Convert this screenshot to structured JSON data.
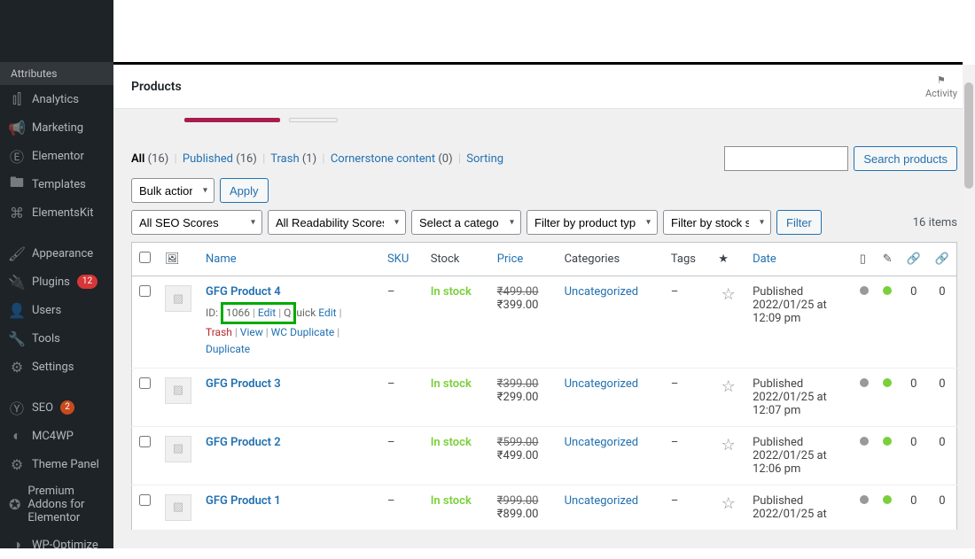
{
  "sidebar": {
    "attributes": "Attributes",
    "items": [
      {
        "icon": "analytics-icon",
        "glyph": "⫾⫿",
        "label": "Analytics"
      },
      {
        "icon": "marketing-icon",
        "glyph": "📢",
        "label": "Marketing"
      },
      {
        "icon": "elementor-icon",
        "glyph": "Ⓔ",
        "label": "Elementor"
      },
      {
        "icon": "templates-icon",
        "glyph": "🖿",
        "label": "Templates"
      },
      {
        "icon": "elementskit-icon",
        "glyph": "⌘",
        "label": "ElementsKit"
      },
      {
        "icon": "appearance-icon",
        "glyph": "🖌",
        "label": "Appearance"
      },
      {
        "icon": "plugins-icon",
        "glyph": "🔌",
        "label": "Plugins",
        "badge": "12",
        "badge_class": "badge-red"
      },
      {
        "icon": "users-icon",
        "glyph": "👤",
        "label": "Users"
      },
      {
        "icon": "tools-icon",
        "glyph": "🔧",
        "label": "Tools"
      },
      {
        "icon": "settings-icon",
        "glyph": "⚙",
        "label": "Settings"
      },
      {
        "icon": "seo-icon",
        "glyph": "Ⓨ",
        "label": "SEO",
        "badge": "2",
        "badge_class": "badge-orange"
      },
      {
        "icon": "mc4wp-icon",
        "glyph": "◐",
        "label": "MC4WP"
      },
      {
        "icon": "theme-panel-icon",
        "glyph": "⚙",
        "label": "Theme Panel"
      },
      {
        "icon": "premium-addons-icon",
        "glyph": "✪",
        "label": "Premium Addons for Elementor"
      },
      {
        "icon": "wp-optimize-icon",
        "glyph": "◑",
        "label": "WP-Optimize"
      }
    ]
  },
  "header": {
    "title": "Products",
    "activity": "Activity"
  },
  "filters": {
    "all": "All",
    "all_count": "(16)",
    "published": "Published",
    "published_count": "(16)",
    "trash": "Trash",
    "trash_count": "(1)",
    "cornerstone": "Cornerstone content",
    "cornerstone_count": "(0)",
    "sorting": "Sorting",
    "search_btn": "Search products",
    "bulk": "Bulk actions",
    "apply": "Apply",
    "seo": "All SEO Scores",
    "readability": "All Readability Scores",
    "category": "Select a category",
    "ptype": "Filter by product type",
    "stock": "Filter by stock status",
    "filter_btn": "Filter",
    "items": "16 items"
  },
  "columns": {
    "name": "Name",
    "sku": "SKU",
    "stock": "Stock",
    "price": "Price",
    "categories": "Categories",
    "tags": "Tags",
    "date": "Date"
  },
  "row_actions": {
    "id_prefix": "ID: ",
    "edit": "Edit",
    "quick_edit": "Quick Edit",
    "trash": "Trash",
    "view": "View",
    "wc_dup": "WC Duplicate",
    "dup": "Duplicate"
  },
  "products": [
    {
      "name": "GFG Product 4",
      "id": "1066",
      "sku": "–",
      "stock": "In stock",
      "price_old": "₹499.00",
      "price_new": "₹399.00",
      "category": "Uncategorized",
      "tags": "–",
      "date_label": "Published",
      "date_line2": "2022/01/25 at",
      "date_line3": "12:09 pm",
      "c1": "0",
      "c2": "0",
      "show_actions": true
    },
    {
      "name": "GFG Product 3",
      "sku": "–",
      "stock": "In stock",
      "price_old": "₹399.00",
      "price_new": "₹299.00",
      "category": "Uncategorized",
      "tags": "–",
      "date_label": "Published",
      "date_line2": "2022/01/25 at",
      "date_line3": "12:07 pm",
      "c1": "0",
      "c2": "0"
    },
    {
      "name": "GFG Product 2",
      "sku": "–",
      "stock": "In stock",
      "price_old": "₹599.00",
      "price_new": "₹499.00",
      "category": "Uncategorized",
      "tags": "–",
      "date_label": "Published",
      "date_line2": "2022/01/25 at",
      "date_line3": "12:06 pm",
      "c1": "0",
      "c2": "0"
    },
    {
      "name": "GFG Product 1",
      "sku": "–",
      "stock": "In stock",
      "price_old": "₹999.00",
      "price_new": "₹899.00",
      "category": "Uncategorized",
      "tags": "–",
      "date_label": "Published",
      "date_line2": "2022/01/25 at",
      "date_line3": "",
      "c1": "0",
      "c2": "0"
    }
  ]
}
